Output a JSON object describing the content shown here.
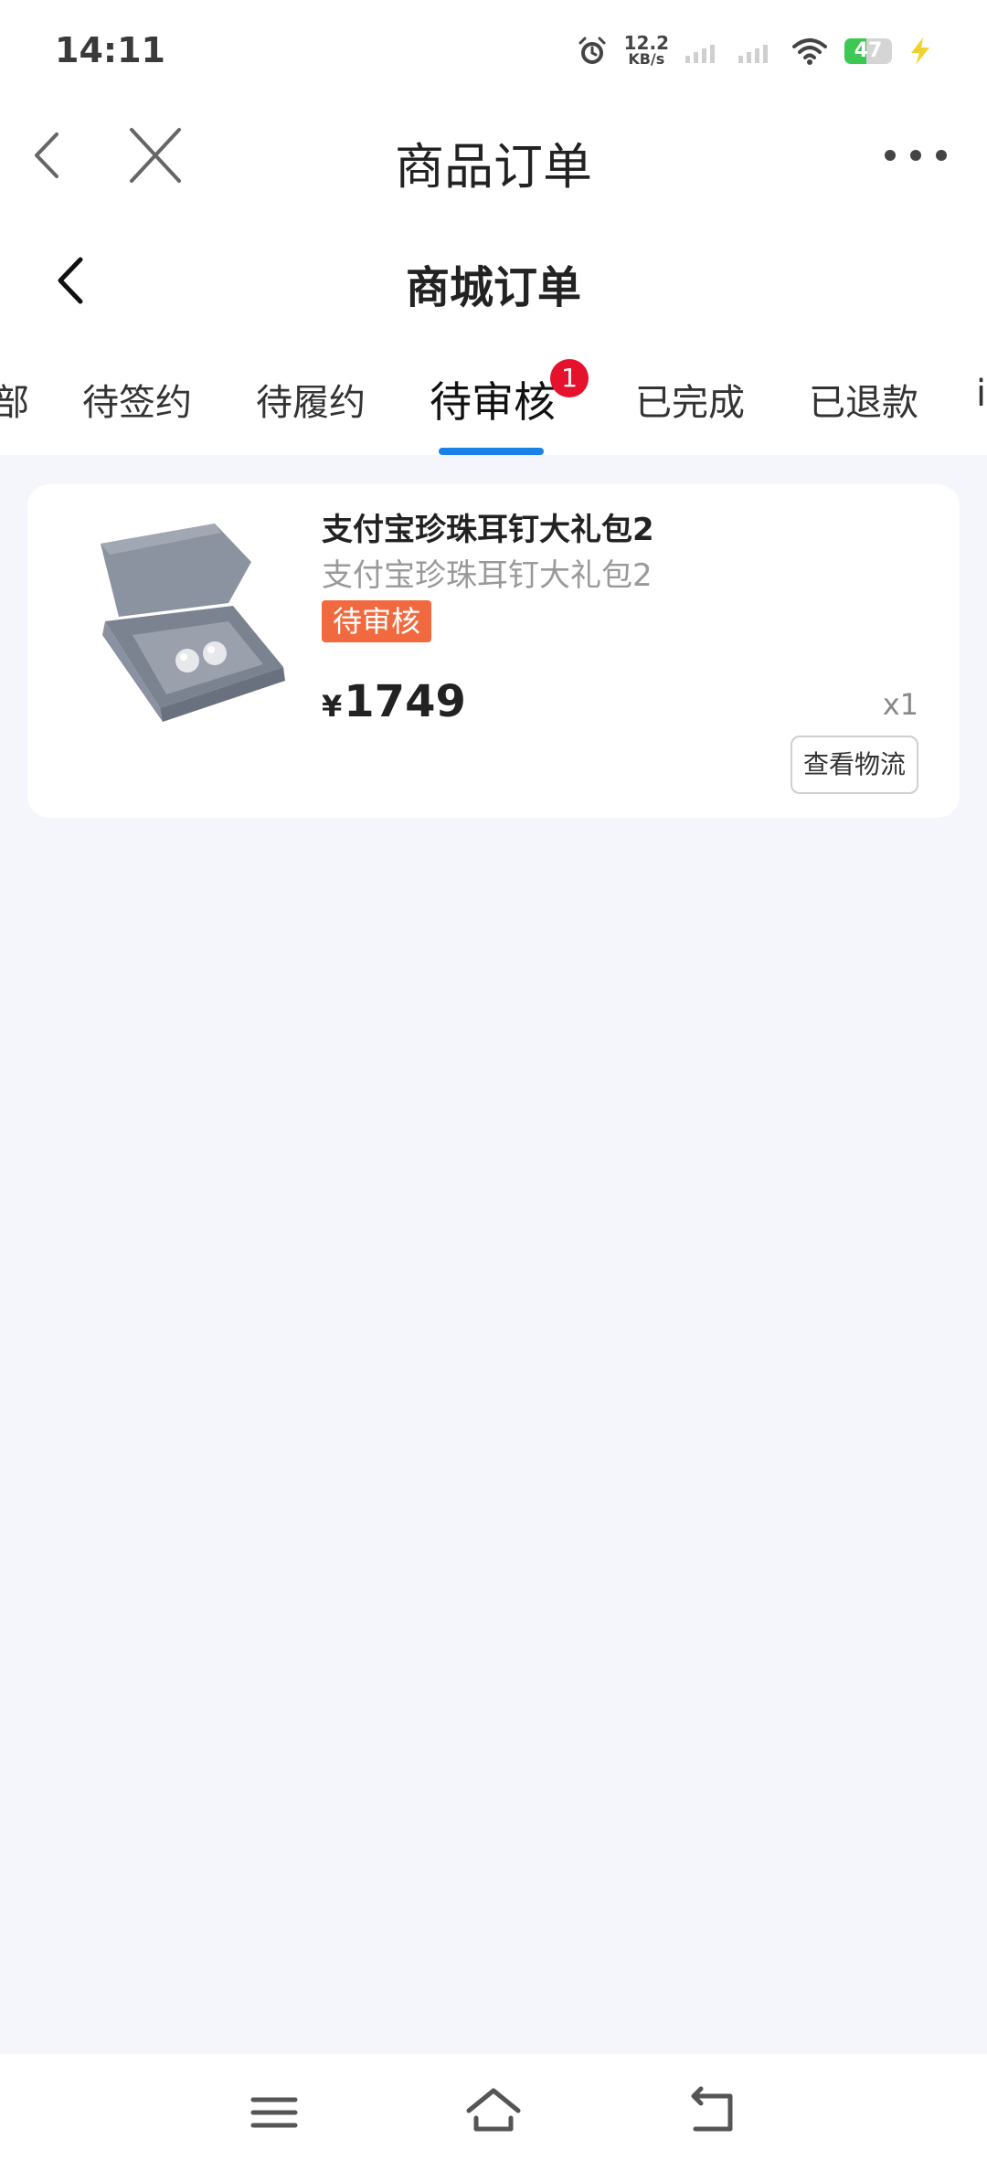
{
  "status_bar": {
    "time": "14:11",
    "net_speed_value": "12.2",
    "net_speed_unit": "KB/s",
    "battery_level": "47",
    "battery_fraction": 0.47,
    "battery_color": "#3cc852"
  },
  "app_header": {
    "title": "商品订单",
    "back_icon": "chevron-left-icon",
    "close_icon": "close-icon",
    "more_icon": "more-horizontal-icon"
  },
  "sub_header": {
    "title": "商城订单",
    "back_icon": "chevron-left-icon"
  },
  "tabs": {
    "items": [
      {
        "label": "部",
        "active": false
      },
      {
        "label": "待签约",
        "active": false
      },
      {
        "label": "待履约",
        "active": false
      },
      {
        "label": "待审核",
        "active": true,
        "badge": "1"
      },
      {
        "label": "已完成",
        "active": false
      },
      {
        "label": "已退款",
        "active": false
      },
      {
        "label": "i",
        "active": false
      }
    ],
    "indicator_color": "#1a82e6",
    "badge_color": "#e5112d"
  },
  "order": {
    "product_name": "支付宝珍珠耳钉大礼包2",
    "product_subtitle": "支付宝珍珠耳钉大礼包2",
    "status": "待审核",
    "status_color": "#f16a3f",
    "currency_symbol": "¥",
    "price": "1749",
    "quantity": "x1",
    "logistics_button": "查看物流"
  },
  "nav_bar": {
    "icons": [
      "menu-icon",
      "home-icon",
      "back-icon"
    ]
  }
}
